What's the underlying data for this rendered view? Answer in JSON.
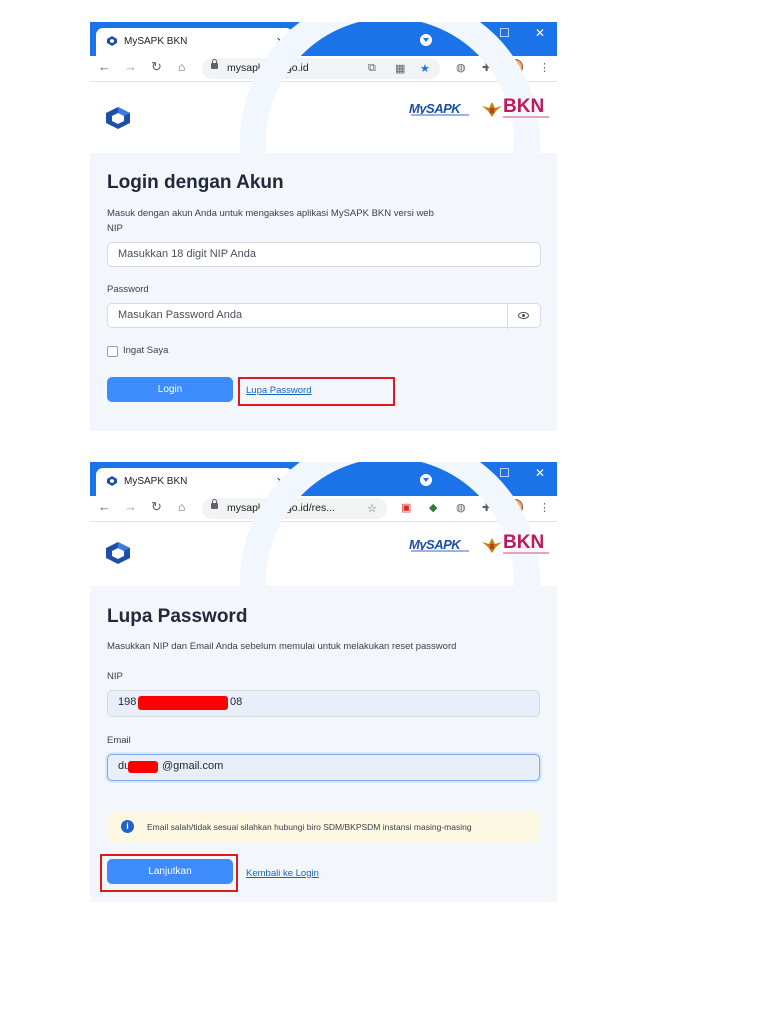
{
  "colors": {
    "browser_blue": "#1a73e8",
    "button_blue": "#3d8bfd",
    "highlight_red": "#e0191f",
    "card_bg": "#f3f6fb",
    "alert_bg": "#fdf8e1"
  },
  "screenshot1": {
    "tab_title": "MySAPK BKN",
    "url": "mysapk.bkn.go.id",
    "brand_mysapk": "MySAPK",
    "brand_bkn": "BKN",
    "heading": "Login dengan Akun",
    "subtitle": "Masuk dengan akun Anda untuk mengakses aplikasi MySAPK BKN versi web",
    "nip_label": "NIP",
    "nip_placeholder": "Masukkan 18 digit NIP Anda",
    "password_label": "Password",
    "password_placeholder": "Masukan Password Anda",
    "remember_label": "Ingat Saya",
    "login_button": "Login",
    "forgot_link": "Lupa Password"
  },
  "screenshot2": {
    "tab_title": "MySAPK BKN",
    "url": "mysapk.bkn.go.id/res...",
    "brand_mysapk": "MySAPK",
    "brand_bkn": "BKN",
    "heading": "Lupa Password",
    "subtitle": "Masukkan NIP dan Email Anda sebelum memulai untuk melakukan reset password",
    "nip_label": "NIP",
    "nip_prefix": "198",
    "nip_suffix": "08",
    "email_label": "Email",
    "email_prefix": "du",
    "email_suffix": "@gmail.com",
    "alert_text": "Email salah/tidak sesuai silahkan hubungi biro SDM/BKPSDM instansi masing-masing",
    "continue_button": "Lanjutkan",
    "back_link": "Kembali ke Login"
  },
  "icons": [
    "back-arrow-icon",
    "forward-arrow-icon",
    "reload-icon",
    "home-icon",
    "lock-icon",
    "star-icon",
    "extensions-icon",
    "eye-icon",
    "info-icon",
    "close-icon",
    "new-tab-icon"
  ]
}
